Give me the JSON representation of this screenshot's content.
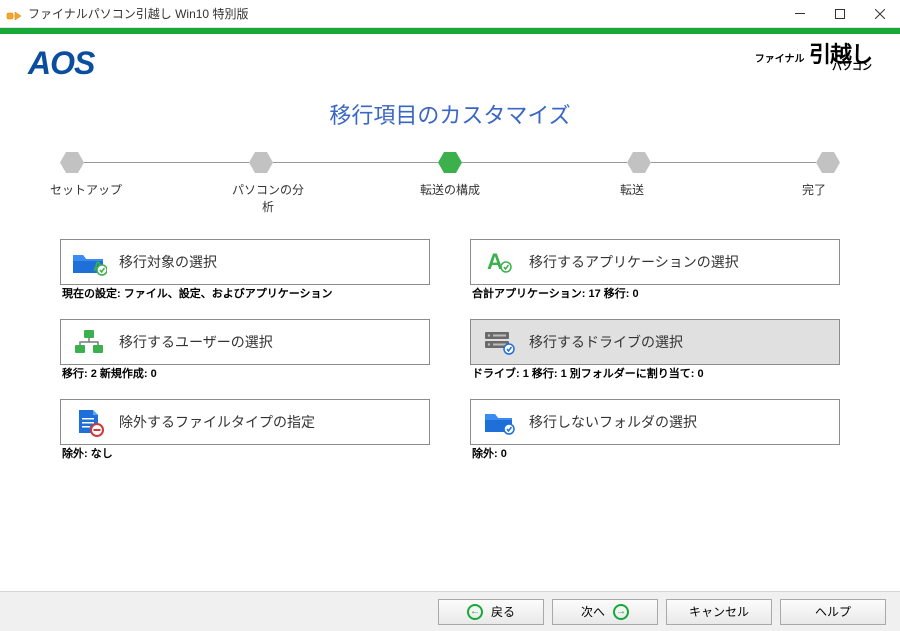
{
  "window": {
    "title": "ファイナルパソコン引越し Win10 特別版"
  },
  "header": {
    "aos_logo": "AOS",
    "brand_small1": "ファイナル",
    "brand_small2": "パソコン",
    "brand_big": "引越し"
  },
  "page_title": "移行項目のカスタマイズ",
  "progress": {
    "steps": [
      "セットアップ",
      "パソコンの分析",
      "転送の構成",
      "転送",
      "完了"
    ],
    "current_index": 2
  },
  "options": {
    "select_targets": {
      "label": "移行対象の選択",
      "sub": "現在の設定: ファイル、設定、およびアプリケーション"
    },
    "select_apps": {
      "label": "移行するアプリケーションの選択",
      "sub": "合計アプリケーション: 17 移行: 0"
    },
    "select_users": {
      "label": "移行するユーザーの選択",
      "sub": "移行: 2 新規作成: 0"
    },
    "select_drives": {
      "label": "移行するドライブの選択",
      "sub": "ドライブ: 1 移行: 1 別フォルダーに割り当て: 0"
    },
    "exclude_types": {
      "label": "除外するファイルタイプの指定",
      "sub": "除外: なし"
    },
    "exclude_folders": {
      "label": "移行しないフォルダの選択",
      "sub": "除外: 0"
    }
  },
  "buttons": {
    "back": "戻る",
    "next": "次へ",
    "cancel": "キャンセル",
    "help": "ヘルプ"
  }
}
